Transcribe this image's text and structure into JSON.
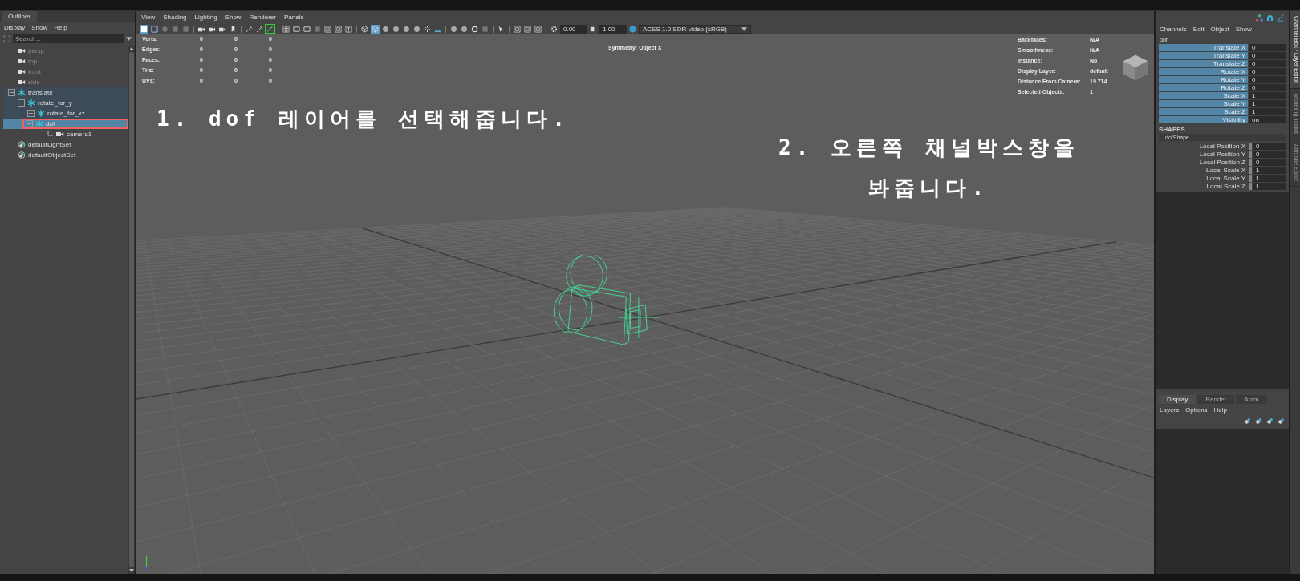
{
  "outliner": {
    "tab": "Outliner",
    "menu": [
      "Display",
      "Show",
      "Help"
    ],
    "search": {
      "placeholder": "Search..."
    },
    "items": [
      {
        "kind": "camera",
        "label": "persp",
        "dimmed": true,
        "selected": false
      },
      {
        "kind": "camera",
        "label": "top",
        "dimmed": true,
        "selected": false
      },
      {
        "kind": "camera",
        "label": "front",
        "dimmed": true,
        "selected": false
      },
      {
        "kind": "camera",
        "label": "side",
        "dimmed": true,
        "selected": false
      },
      {
        "kind": "transform",
        "label": "translate",
        "dimmed": false,
        "selected": false,
        "expanded": true,
        "children": [
          {
            "kind": "transform",
            "label": "rotate_for_y",
            "dimmed": false,
            "selected": false,
            "expanded": true,
            "children": [
              {
                "kind": "transform",
                "label": "rotate_for_xz",
                "dimmed": false,
                "selected": false,
                "expanded": true,
                "children": [
                  {
                    "kind": "transform",
                    "label": "dof",
                    "dimmed": false,
                    "selected": true,
                    "outlined": true,
                    "expanded": true,
                    "children": [
                      {
                        "kind": "camera",
                        "label": "camera1",
                        "dimmed": false,
                        "selected": false
                      }
                    ]
                  }
                ]
              }
            ]
          }
        ]
      },
      {
        "kind": "set",
        "label": "defaultLightSet",
        "dimmed": false,
        "selected": false
      },
      {
        "kind": "set",
        "label": "defaultObjectSet",
        "dimmed": false,
        "selected": false
      }
    ]
  },
  "viewport": {
    "menu": [
      "View",
      "Shading",
      "Lighting",
      "Show",
      "Renderer",
      "Panels"
    ],
    "exposure": "0.00",
    "gamma": "1.00",
    "color_space": "ACES 1.0 SDR-video (sRGB)",
    "hud_left": [
      {
        "label": "Verts:",
        "values": [
          "0",
          "0",
          "0"
        ]
      },
      {
        "label": "Edges:",
        "values": [
          "0",
          "0",
          "0"
        ]
      },
      {
        "label": "Faces:",
        "values": [
          "0",
          "0",
          "0"
        ]
      },
      {
        "label": "Tris:",
        "values": [
          "0",
          "0",
          "0"
        ]
      },
      {
        "label": "UVs:",
        "values": [
          "0",
          "0",
          "0"
        ]
      }
    ],
    "symmetry": "Symmetry: Object X",
    "hud_right": [
      {
        "label": "Backfaces:",
        "value": "N/A"
      },
      {
        "label": "Smoothness:",
        "value": "N/A"
      },
      {
        "label": "Instance:",
        "value": "No"
      },
      {
        "label": "Display Layer:",
        "value": "default"
      },
      {
        "label": "Distance From Camera:",
        "value": "19.714"
      },
      {
        "label": "Selected Objects:",
        "value": "1"
      }
    ],
    "annotations": [
      {
        "lines": [
          "1. dof 레이어를 선택해줍니다."
        ]
      },
      {
        "lines": [
          "2. 오른쪽 채널박스창을",
          "봐줍니다."
        ]
      }
    ]
  },
  "channel_box": {
    "menu": [
      "Channels",
      "Edit",
      "Object",
      "Show"
    ],
    "object": "dof",
    "channels": [
      {
        "name": "Translate X",
        "value": "0"
      },
      {
        "name": "Translate Y",
        "value": "0"
      },
      {
        "name": "Translate Z",
        "value": "0"
      },
      {
        "name": "Rotate X",
        "value": "0"
      },
      {
        "name": "Rotate Y",
        "value": "0"
      },
      {
        "name": "Rotate Z",
        "value": "0"
      },
      {
        "name": "Scale X",
        "value": "1"
      },
      {
        "name": "Scale Y",
        "value": "1"
      },
      {
        "name": "Scale Z",
        "value": "1"
      },
      {
        "name": "Visibility",
        "value": "on"
      }
    ],
    "shapes_header": "SHAPES",
    "shape": "dofShape",
    "shape_channels": [
      {
        "name": "Local Position X",
        "value": "0"
      },
      {
        "name": "Local Position Y",
        "value": "0"
      },
      {
        "name": "Local Position Z",
        "value": "0"
      },
      {
        "name": "Local Scale X",
        "value": "1"
      },
      {
        "name": "Local Scale Y",
        "value": "1"
      },
      {
        "name": "Local Scale Z",
        "value": "1"
      }
    ]
  },
  "layer_editor": {
    "tabs": [
      {
        "label": "Display",
        "selected": true
      },
      {
        "label": "Render",
        "selected": false
      },
      {
        "label": "Anim",
        "selected": false
      }
    ],
    "menu": [
      "Layers",
      "Options",
      "Help"
    ]
  },
  "side_tabs": [
    {
      "label": "Channel Box / Layer Editor",
      "selected": true
    },
    {
      "label": "Modeling Toolkit",
      "selected": false
    },
    {
      "label": "Attribute Editor",
      "selected": false
    }
  ]
}
